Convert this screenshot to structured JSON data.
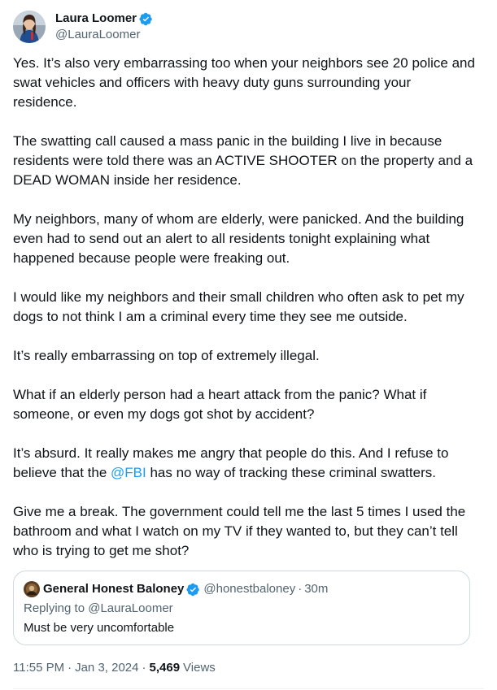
{
  "author": {
    "display_name": "Laura Loomer",
    "handle": "@LauraLoomer",
    "verified": true,
    "avatar_icon": "profile-photo-icon"
  },
  "tweet": {
    "paragraphs": [
      {
        "text": "Yes. It’s also very embarrassing too when your neighbors see 20 police and swat vehicles and officers with heavy duty guns surrounding your residence."
      },
      {
        "text": "The swatting call caused a mass panic in the building I live in because residents were told there was an ACTIVE SHOOTER on the property and a DEAD WOMAN inside her residence."
      },
      {
        "text": "My neighbors, many of whom are elderly, were panicked. And the building even had to send out an alert to all residents tonight explaining what happened because people were freaking out."
      },
      {
        "text": "I would like my neighbors and their small children who often ask to pet my dogs to not think I am a criminal every time they see me outside."
      },
      {
        "text": "It’s really embarrassing on top of extremely illegal."
      },
      {
        "text": "What if an elderly person had a heart attack from the panic? What if someone,  or even my dogs got shot by accident?"
      },
      {
        "before": "It’s absurd. It really makes me angry that people do this. And I refuse to believe that the ",
        "mention": "@FBI",
        "after": " has no way of tracking these criminal swatters."
      },
      {
        "text": "Give me a break. The government could tell me the last 5 times I used the bathroom and what I watch on my TV if they wanted to, but they can’t tell who is trying to get me shot?"
      }
    ]
  },
  "quote": {
    "display_name": "General Honest Baloney",
    "handle": "@honestbaloney",
    "separator": "·",
    "time": "30m",
    "verified": true,
    "reply_context": "Replying to @LauraLoomer",
    "text": "Must be very uncomfortable"
  },
  "meta": {
    "time": "11:55 PM",
    "dot1": "·",
    "date": "Jan 3, 2024",
    "dot2": "·",
    "views_count": "5,469",
    "views_label": "Views"
  },
  "colors": {
    "link": "#1d9bf0",
    "secondary_text": "#536471",
    "primary_text": "#0f1419",
    "verified": "#1d9bf0"
  }
}
